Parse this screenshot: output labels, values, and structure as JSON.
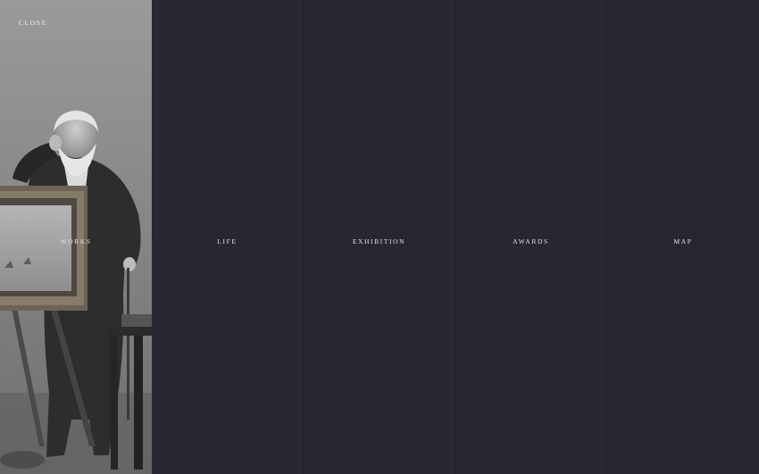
{
  "close_label": "CLOSE",
  "panels": [
    {
      "label": "WORKS"
    },
    {
      "label": "LIFE"
    },
    {
      "label": "EXHIBITION"
    },
    {
      "label": "AWARDS"
    },
    {
      "label": "MAP"
    }
  ],
  "colors": {
    "panel_bg": "#262730",
    "label_text": "#e3e3e6"
  }
}
